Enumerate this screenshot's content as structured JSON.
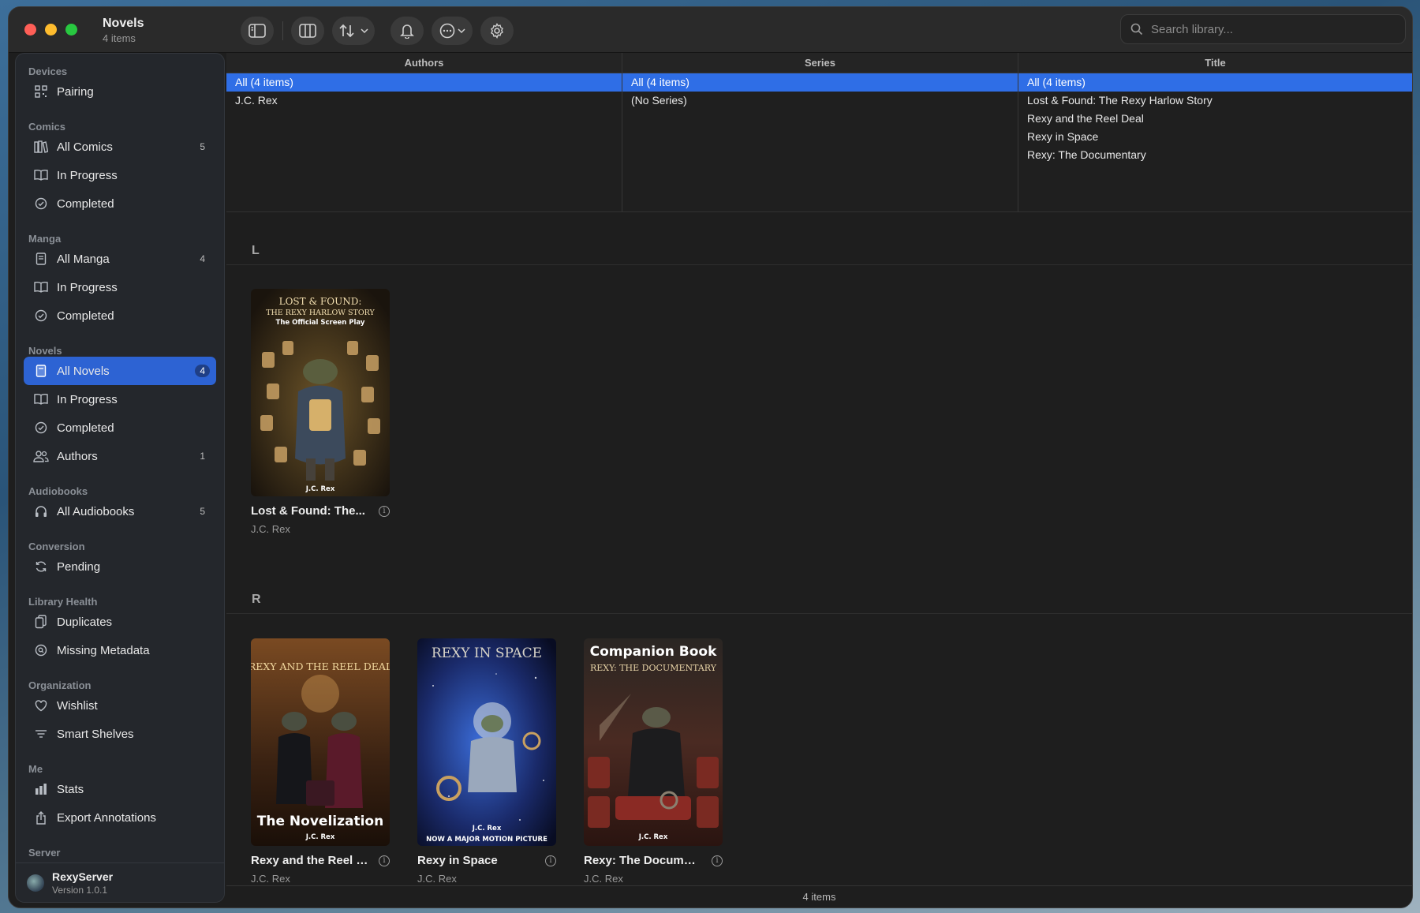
{
  "window": {
    "title": "Novels",
    "subtitle": "4 items"
  },
  "search": {
    "placeholder": "Search library..."
  },
  "sidebar": {
    "sections": {
      "devices": "Devices",
      "comics": "Comics",
      "manga": "Manga",
      "novels": "Novels",
      "audiobooks": "Audiobooks",
      "conversion": "Conversion",
      "library_health": "Library Health",
      "organization": "Organization",
      "me": "Me",
      "server": "Server"
    },
    "items": {
      "pairing": "Pairing",
      "all_comics": "All Comics",
      "all_comics_count": "5",
      "comics_in_progress": "In Progress",
      "comics_completed": "Completed",
      "all_manga": "All Manga",
      "all_manga_count": "4",
      "manga_in_progress": "In Progress",
      "manga_completed": "Completed",
      "all_novels": "All Novels",
      "all_novels_count": "4",
      "novels_in_progress": "In Progress",
      "novels_completed": "Completed",
      "authors": "Authors",
      "authors_count": "1",
      "all_audiobooks": "All Audiobooks",
      "all_audiobooks_count": "5",
      "pending": "Pending",
      "duplicates": "Duplicates",
      "missing_metadata": "Missing Metadata",
      "wishlist": "Wishlist",
      "smart_shelves": "Smart Shelves",
      "stats": "Stats",
      "export_annotations": "Export Annotations"
    },
    "server": {
      "name": "RexyServer",
      "version": "Version 1.0.1"
    }
  },
  "browser": {
    "authors": {
      "header": "Authors",
      "rows": [
        "All (4 items)",
        "J.C. Rex"
      ]
    },
    "series": {
      "header": "Series",
      "rows": [
        "All (4 items)",
        "(No Series)"
      ]
    },
    "title": {
      "header": "Title",
      "rows": [
        "All (4 items)",
        "Lost & Found: The Rexy Harlow Story",
        "Rexy and the Reel Deal",
        "Rexy in Space",
        "Rexy: The Documentary"
      ]
    }
  },
  "groups": [
    {
      "letter": "L",
      "books": [
        {
          "title": "Lost & Found: The...",
          "author": "J.C. Rex",
          "cover": {
            "line1": "LOST & FOUND:",
            "line2": "THE REXY HARLOW STORY",
            "line3": "The Official Screen Play",
            "author": "J.C. Rex"
          }
        }
      ]
    },
    {
      "letter": "R",
      "books": [
        {
          "title": "Rexy and the Reel D...",
          "author": "J.C. Rex",
          "cover": {
            "line1": "REXY AND THE REEL DEAL",
            "bottom": "The Novelization",
            "author": "J.C. Rex"
          }
        },
        {
          "title": "Rexy in Space",
          "author": "J.C. Rex",
          "cover": {
            "line1": "REXY IN SPACE",
            "author": "J.C. Rex",
            "tag": "NOW A MAJOR MOTION PICTURE"
          }
        },
        {
          "title": "Rexy: The Documen...",
          "author": "J.C. Rex",
          "cover": {
            "line1": "Companion Book",
            "line2": "REXY: THE DOCUMENTARY",
            "author": "J.C. Rex"
          }
        }
      ]
    }
  ],
  "status": {
    "text": "4 items"
  },
  "colors": {
    "accent": "#2d63d3",
    "selection": "#2f6ee6"
  }
}
